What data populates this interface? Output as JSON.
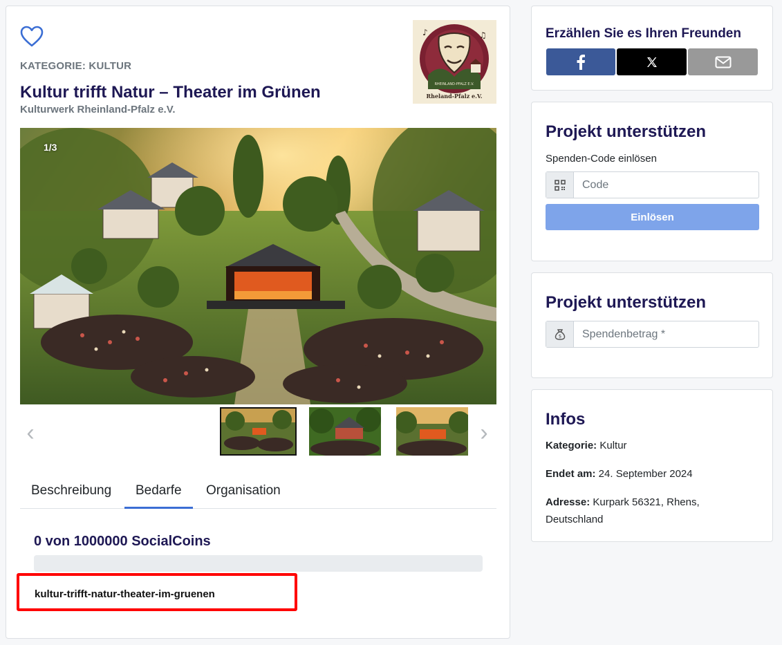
{
  "project": {
    "category_label": "KATEGORIE: KULTUR",
    "title": "Kultur trifft Natur – Theater im Grünen",
    "organization": "Kulturwerk Rheinland-Pfalz e.V.",
    "logo_text": "Rheland-Pfalz e.V.",
    "logo_arc_text": "RHEINLAND-PFALZ E.V."
  },
  "gallery": {
    "counter": "1/3",
    "progress_fraction": 0
  },
  "tabs": [
    {
      "label": "Beschreibung"
    },
    {
      "label": "Bedarfe"
    },
    {
      "label": "Organisation"
    }
  ],
  "needs": {
    "coins_text": "0 von 1000000 SocialCoins",
    "progress": 0,
    "slug": "kultur-trifft-natur-theater-im-gruenen"
  },
  "share": {
    "title": "Erzählen Sie es Ihren Freunden",
    "facebook_icon": "facebook-icon",
    "x_icon": "x-icon",
    "mail_icon": "mail-icon",
    "colors": {
      "facebook": "#3b5998",
      "x": "#000000",
      "mail": "#999999"
    }
  },
  "support_code": {
    "title": "Projekt unterstützen",
    "label": "Spenden-Code einlösen",
    "placeholder": "Code",
    "button": "Einlösen"
  },
  "support_amount": {
    "title": "Projekt unterstützen",
    "placeholder": "Spendenbetrag *"
  },
  "infos": {
    "title": "Infos",
    "category_key": "Kategorie:",
    "category_value": " Kultur",
    "end_key": "Endet am:",
    "end_value": " 24. September 2024",
    "address_key": "Adresse:",
    "address_value": " Kurpark 56321, Rhens, Deutschland"
  },
  "colors": {
    "accent": "#3b6ed4",
    "title": "#1e1854",
    "muted": "#6c757d",
    "highlight": "#ff0000"
  }
}
